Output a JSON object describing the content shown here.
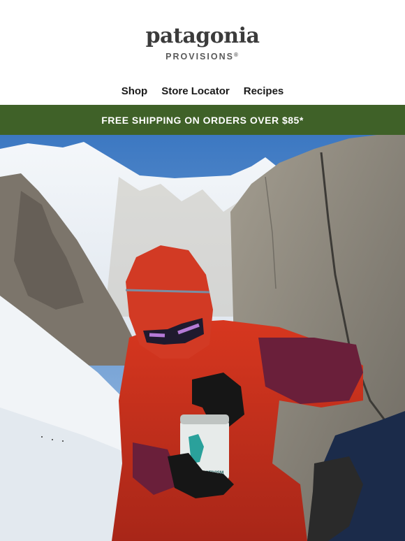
{
  "brand": {
    "wordmark": "patagonia",
    "subbrand": "PROVISIONS",
    "reg_mark": "®"
  },
  "nav": {
    "items": [
      {
        "label": "Shop"
      },
      {
        "label": "Store Locator"
      },
      {
        "label": "Recipes"
      }
    ]
  },
  "banner": {
    "text": "FREE SHIPPING ON ORDERS OVER $85*"
  },
  "hero": {
    "can_label": "EATING IS ACTIVISM",
    "colors": {
      "sky": "#4f86c6",
      "snow": "#eef2f5",
      "rock": "#8c8a82",
      "jacket": "#c8301f",
      "accent": "#6a1f3a"
    }
  },
  "colors": {
    "banner_bg": "#3f6128",
    "banner_text": "#ffffff",
    "nav_text": "#1a1a1a"
  }
}
